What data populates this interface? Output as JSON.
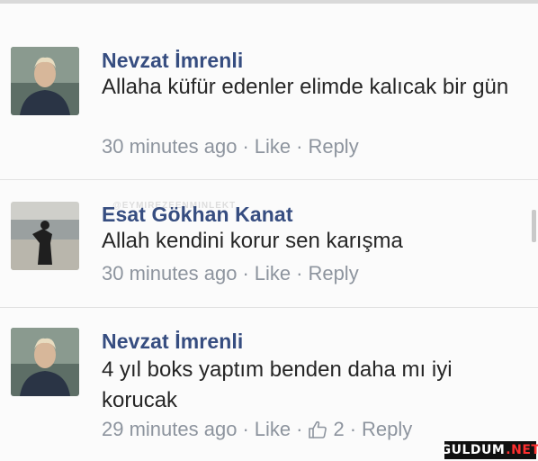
{
  "comments": [
    {
      "author": "Nevzat İmrenli",
      "text": "Allaha küfür edenler elimde kalıcak bir gün",
      "time": "30 minutes ago",
      "like": "Like",
      "reply": "Reply",
      "avatar": "portrait-man"
    },
    {
      "author": "Esat Gökhan Kanat",
      "text": "Allah kendini korur sen karışma",
      "time": "30 minutes ago",
      "like": "Like",
      "reply": "Reply",
      "avatar": "person-on-beach"
    },
    {
      "author": "Nevzat İmrenli",
      "text": "4 yıl boks yaptım benden daha mı iyi korucak",
      "time": "29 minutes ago",
      "like": "Like",
      "like_count": "2",
      "reply": "Reply",
      "avatar": "portrait-man"
    }
  ],
  "watermark": "@EYMIREZEENMINLEKT",
  "logo": {
    "main": "GULDUM",
    "suffix": ".NET"
  },
  "icons": {
    "like": "thumbs-up-icon"
  },
  "colors": {
    "name": "#364d80",
    "meta": "#8d949e",
    "text": "#262626"
  }
}
